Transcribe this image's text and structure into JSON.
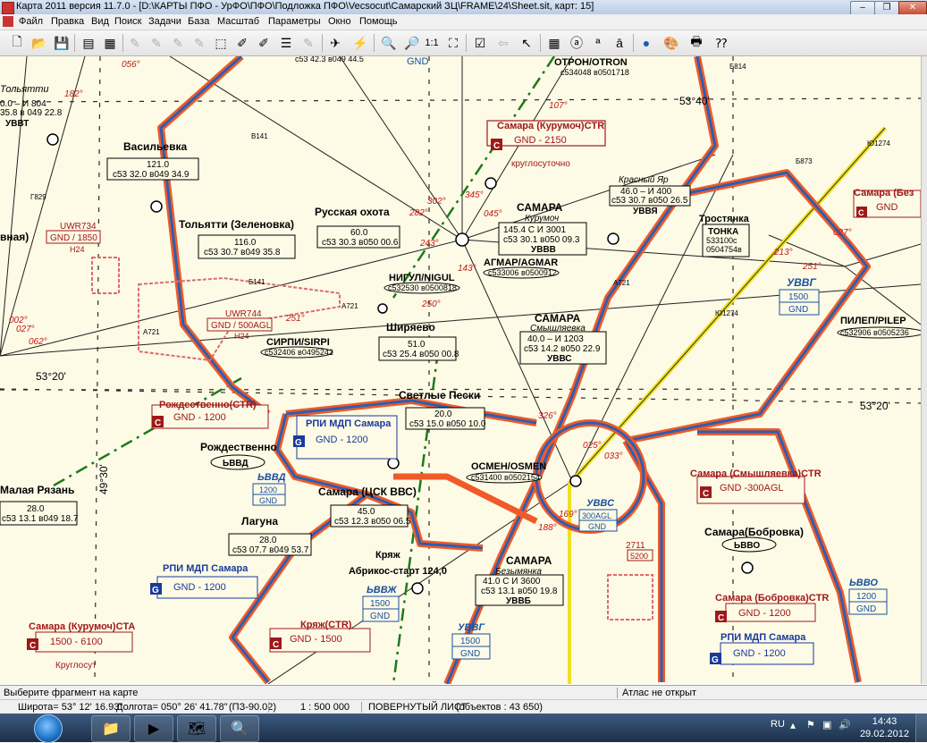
{
  "window": {
    "title": "Карта 2011 версия 11.7.0 - [D:\\КАРТЫ ПФО - УрФО\\ПФО\\Подложка ПФО\\Vecsocut\\Самарский ЗЦ\\FRAME\\24\\Sheet.sit, карт: 15]",
    "minimize": "–",
    "restore": "❐",
    "close": "✕"
  },
  "menu": [
    "Файл",
    "Правка",
    "Вид",
    "Поиск",
    "Задачи",
    "База",
    "Масштаб",
    "Параметры",
    "Окно",
    "Помощь"
  ],
  "toolbar": {
    "scale_label": "1:1"
  },
  "map": {
    "grid_labels": {
      "lat_5340": "53°40'",
      "lat_5320_left": "53°20'",
      "lat_5320_right": "53°20'",
      "lon_4930": "49°30'"
    },
    "airports": [
      {
        "name": "Васильевка",
        "freq": "121.0",
        "coords": "с53 32.0 в049 34.9"
      },
      {
        "name": "Тольятти (Зеленовка)",
        "freq": "116.0",
        "coords": "с53 30.7 в049 35.8"
      },
      {
        "name": "Русская охота",
        "freq": "60.0",
        "coords": "с53 30.3 в050 00.6"
      },
      {
        "name": "Ширяево",
        "freq": "51.0",
        "coords": "с53 25.4 в050 00.8"
      },
      {
        "name": "Светлые Пески",
        "freq": "20.0",
        "coords": "с53 15.0 в050 10.0"
      },
      {
        "name": "Рождественно",
        "code": "ЬВВД"
      },
      {
        "name": "Самара (ЦСК ВВС)",
        "freq": "45.0",
        "coords": "с53 12.3 в050 06.5"
      },
      {
        "name": "Лагуна",
        "freq": "28.0",
        "coords": "с53 07.7 в049 53.7"
      },
      {
        "name": "Малая Рязань",
        "freq": "28.0",
        "coords": "с53 13.1 в049 18.7"
      },
      {
        "name": "Самара(Бобровка)",
        "code": "ЬВВО"
      },
      {
        "name": "Тростянка",
        "sub": "ТОНКА",
        "coords1": "533100с",
        "coords2": "0504754в"
      }
    ],
    "vor_samara_kurumoch": {
      "name": "САМАРА",
      "sub": "Курумоч",
      "freq": "145.4  С  И  3001",
      "coords": "с53 30.1  в050 09.3",
      "code": "УВВВ"
    },
    "vor_samara_smyshlyaevka": {
      "name": "САМАРА",
      "sub": "Смышляевка",
      "freq": "40.0  –  И  1203",
      "coords": "с53 14.2  в050 22.9",
      "code": "УВВС"
    },
    "vor_samara_bezymyanka": {
      "name": "САМАРА",
      "sub": "Безымянка",
      "freq": "41.0  С  И  3600",
      "coords": "с53 13.1  в050 19.8",
      "code": "УВВБ"
    },
    "vor_krasny_yar": {
      "name": "Красный Яр",
      "freq": "46.0  –  И  400",
      "coords": "с53 30.7  в050 26.5",
      "code": "УВВЯ"
    },
    "vor_tolyatti": {
      "name": "Тольятти",
      "freq": "0.0  –  И  804",
      "coords": "35.8  в 049 22.8",
      "code": "УВВТ"
    },
    "waypoints": [
      {
        "name": "ОТРОН/OTRON",
        "coords": "с534048 в0501718"
      },
      {
        "name": "АГМАР/AGMAR",
        "coords": "с533006 в0500912"
      },
      {
        "name": "НИГУЛ/NIGUL",
        "coords": "с532530 в0500818"
      },
      {
        "name": "СИРПИ/SIRPI",
        "coords": "с532406 в0495242"
      },
      {
        "name": "ОСМЕН/OSMEN",
        "coords": "с531400 в0502154"
      },
      {
        "name": "ПИЛЕП/PILEP",
        "coords": "с532906 в0505236"
      }
    ],
    "zones": [
      {
        "name": "Самара (Курумоч)CTR",
        "limits": "GND  -  2150",
        "note": "круглосуточно"
      },
      {
        "name": "Рождественно(CTR)",
        "limits": "GND  -  1200"
      },
      {
        "name": "РПИ МДП Самара",
        "limits": "GND  -  1200"
      },
      {
        "name": "РПИ МДП Самара",
        "limits": "GND  -  1200"
      },
      {
        "name": "Кряж(CTR)",
        "limits": "GND  -  1500"
      },
      {
        "name": "Самара (Курумоч)CTA",
        "limits": "1500  -  6100",
        "note": "Круглосут"
      },
      {
        "name": "Самара (Смышляевка)CTR",
        "limits": "GND  -300AGL"
      },
      {
        "name": "Самара (Бобровка)CTR",
        "limits": "GND  -  1200"
      },
      {
        "name": "РПИ МДП Самара",
        "limits": "GND  -  1200"
      },
      {
        "name": "Самара (Без",
        "limits": "GND"
      }
    ],
    "restricted": [
      {
        "name": "UWR734",
        "limits": "GND  /  1850",
        "note": "H24"
      },
      {
        "name": "UWR744",
        "limits": "GND  /  500AGL",
        "note": "H24"
      }
    ],
    "sectors": [
      {
        "code": "ЬВВД",
        "top": "1200",
        "bottom": "GND"
      },
      {
        "code": "ЬВВЖ",
        "top": "1500",
        "bottom": "GND"
      },
      {
        "code": "УВВГ",
        "top": "1500",
        "bottom": "GND"
      },
      {
        "code": "УВВГ",
        "top": "1500",
        "bottom": "GND"
      },
      {
        "code": "УВВС",
        "top": "300AGL",
        "bottom": "GND"
      },
      {
        "code": "ЬВВО",
        "top": "1200",
        "bottom": "GND"
      }
    ],
    "misc_labels": {
      "kryazh": "Кряж",
      "abrikos": "Абрикос-старт 124,0",
      "vnaya": "вная)",
      "tolyatti_partial": "Тольятти",
      "zone_711": "2711",
      "zone_711_limit": "5200",
      "gnd_top": "GND",
      "gnd_top_coords": "с53 42.3 в049 44.5"
    },
    "bearings": [
      "302°",
      "282°",
      "243°",
      "045°",
      "345°",
      "107°",
      "143°",
      "250°",
      "251°",
      "213°",
      "251°",
      "027°",
      "062°",
      "002°",
      "027°",
      "182°",
      "056°",
      "025°",
      "033°",
      "326°",
      "188°",
      "169°"
    ],
    "airways": [
      "A721",
      "A721",
      "B141",
      "Б141",
      "A721",
      "Г829",
      "Б873",
      "Ю1274",
      "Ю1274",
      "Б814"
    ]
  },
  "status": {
    "hint": "Выберите фрагмент на карте",
    "atlas": "Атлас не открыт",
    "latitude": "Широта= 53° 12' 16.93\"",
    "longitude": "Долгота= 050° 26' 41.78\"",
    "datum": "(ПЗ-90.02)",
    "scale": "1 : 500 000",
    "sheet": "ПОВЕРНУТЫЙ ЛИСТ",
    "objects": "(объектов : 43 650)"
  },
  "taskbar": {
    "lang": "RU",
    "time": "14:43",
    "date": "29.02.2012"
  }
}
